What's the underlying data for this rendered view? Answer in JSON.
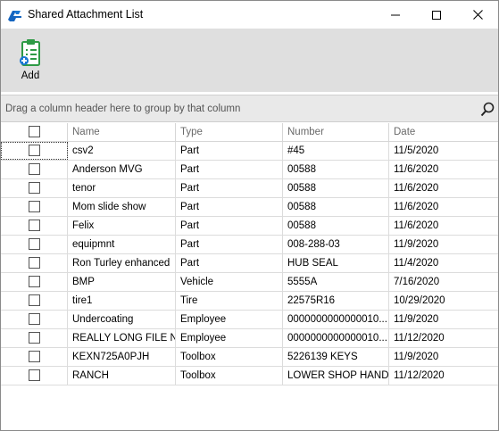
{
  "window": {
    "title": "Shared Attachment List"
  },
  "toolbar": {
    "add_label": "Add"
  },
  "group_panel": {
    "hint": "Drag a column header here to group by that column"
  },
  "grid": {
    "columns": [
      "Name",
      "Type",
      "Number",
      "Date"
    ],
    "rows": [
      {
        "name": "csv2",
        "type": "Part",
        "number": "#45",
        "date": "11/5/2020",
        "checked": false
      },
      {
        "name": "Anderson MVG",
        "type": "Part",
        "number": "00588",
        "date": "11/6/2020",
        "checked": false
      },
      {
        "name": "tenor",
        "type": "Part",
        "number": "00588",
        "date": "11/6/2020",
        "checked": false
      },
      {
        "name": "Mom slide show",
        "type": "Part",
        "number": "00588",
        "date": "11/6/2020",
        "checked": false
      },
      {
        "name": "Felix",
        "type": "Part",
        "number": "00588",
        "date": "11/6/2020",
        "checked": false
      },
      {
        "name": "equipmnt",
        "type": "Part",
        "number": "008-288-03",
        "date": "11/9/2020",
        "checked": false
      },
      {
        "name": "Ron Turley enhanced",
        "type": "Part",
        "number": "HUB SEAL",
        "date": "11/4/2020",
        "checked": false
      },
      {
        "name": "BMP",
        "type": "Vehicle",
        "number": "5555A",
        "date": "7/16/2020",
        "checked": false
      },
      {
        "name": "tire1",
        "type": "Tire",
        "number": "22575R16",
        "date": "10/29/2020",
        "checked": false
      },
      {
        "name": "Undercoating",
        "type": "Employee",
        "number": "0000000000000010...",
        "date": "11/9/2020",
        "checked": false
      },
      {
        "name": "REALLY LONG FILE N...",
        "type": "Employee",
        "number": "0000000000000010...",
        "date": "11/12/2020",
        "checked": false
      },
      {
        "name": "KEXN725A0PJH",
        "type": "Toolbox",
        "number": "5226139 KEYS",
        "date": "11/9/2020",
        "checked": false
      },
      {
        "name": "RANCH",
        "type": "Toolbox",
        "number": "LOWER SHOP HAND ...",
        "date": "11/12/2020",
        "checked": false
      }
    ]
  },
  "icons": {
    "app": "shared-attachment-app-icon",
    "add": "clipboard-add-icon",
    "search": "search-icon",
    "minimize": "minimize-icon",
    "maximize": "maximize-icon",
    "close": "close-icon"
  },
  "colors": {
    "accent": "#1976d2",
    "add_icon_green": "#2e9a45",
    "ribbon_bg": "#dfdfdf"
  }
}
